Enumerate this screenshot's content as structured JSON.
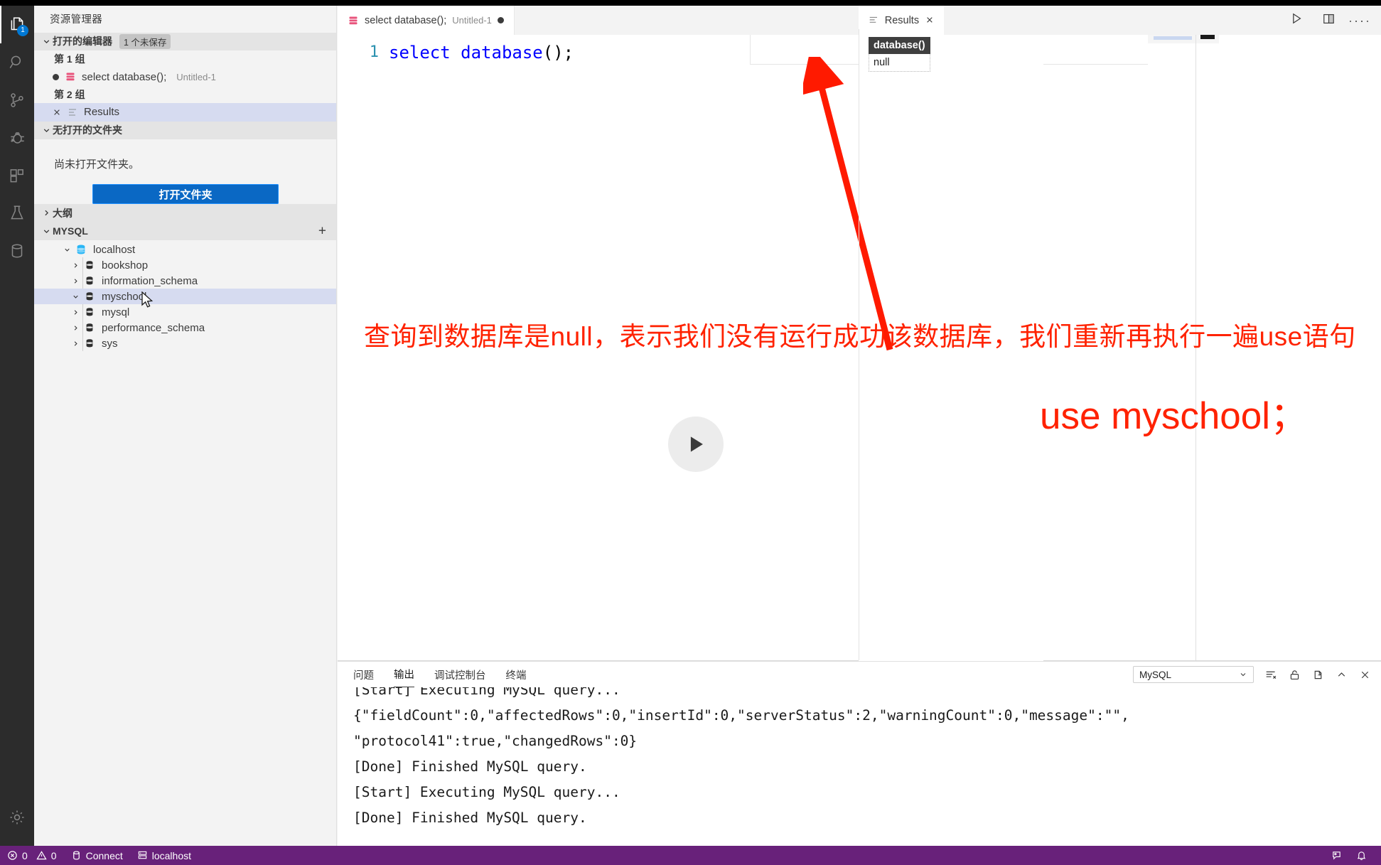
{
  "activitybar": {
    "items": [
      {
        "name": "explorer",
        "icon": "files-icon",
        "badge": "1",
        "active": true
      },
      {
        "name": "search",
        "icon": "search-icon",
        "badge": "",
        "active": false
      },
      {
        "name": "source-control",
        "icon": "source-control-icon",
        "badge": "",
        "active": false
      },
      {
        "name": "run-and-debug",
        "icon": "debug-icon",
        "badge": "",
        "active": false
      },
      {
        "name": "extensions",
        "icon": "extensions-icon",
        "badge": "",
        "active": false
      },
      {
        "name": "testing",
        "icon": "beaker-icon",
        "badge": "",
        "active": false
      },
      {
        "name": "database",
        "icon": "database-icon",
        "badge": "",
        "active": false
      }
    ],
    "settings_label": "manage-gear"
  },
  "sidebar": {
    "title": "资源管理器",
    "open_editors": {
      "label": "打开的编辑器",
      "badge": "1 个未保存",
      "groups": [
        {
          "label": "第 1 组",
          "items": [
            {
              "name": "select database();",
              "sub": "Untitled-1",
              "dirty": true,
              "selected": false
            }
          ]
        },
        {
          "label": "第 2 组",
          "items": [
            {
              "name": "Results",
              "sub": "",
              "dirty": false,
              "selected": true
            }
          ]
        }
      ]
    },
    "no_folder": {
      "label": "无打开的文件夹",
      "message": "尚未打开文件夹。",
      "button": "打开文件夹"
    },
    "outline": {
      "label": "大纲"
    },
    "mysql": {
      "label": "MYSQL",
      "add_label": "+",
      "connection": "localhost",
      "databases": [
        {
          "label": "bookshop",
          "expanded": false,
          "selected": false
        },
        {
          "label": "information_schema",
          "expanded": false,
          "selected": false
        },
        {
          "label": "myschool",
          "expanded": true,
          "selected": true
        },
        {
          "label": "mysql",
          "expanded": false,
          "selected": false
        },
        {
          "label": "performance_schema",
          "expanded": false,
          "selected": false
        },
        {
          "label": "sys",
          "expanded": false,
          "selected": false
        }
      ]
    }
  },
  "editor": {
    "tab": {
      "title": "select database();",
      "sub": "Untitled-1",
      "dirty": true
    },
    "more_actions": "···",
    "line_number": "1",
    "code": {
      "keyword1": "select",
      "keyword2": "database",
      "punct": "();"
    },
    "toolbar": {
      "run_label": "run-query",
      "split_label": "split-editor",
      "more_label": "more-actions"
    },
    "play_overlay": "play-button"
  },
  "results": {
    "tab_label": "Results",
    "close_label": "×",
    "columns": [
      "database()"
    ],
    "rows": [
      [
        "null"
      ]
    ]
  },
  "annotations": {
    "line1": "查询到数据库是null，表示我们没有运行成功该数据库，我们重新再执行一遍use语句",
    "line2": "use myschool；",
    "color": "#ff2200"
  },
  "bottom_panel": {
    "tabs": [
      {
        "label": "问题",
        "active": false
      },
      {
        "label": "输出",
        "active": true
      },
      {
        "label": "调试控制台",
        "active": false
      },
      {
        "label": "终端",
        "active": false
      }
    ],
    "channel": "MySQL",
    "actions": [
      "clear-output-icon",
      "lock-scroll-icon",
      "open-in-editor-icon",
      "chevron-up-icon",
      "close-icon"
    ],
    "output_lines": [
      "[Start] Executing MySQL query...",
      "{\"fieldCount\":0,\"affectedRows\":0,\"insertId\":0,\"serverStatus\":2,\"warningCount\":0,\"message\":\"\",",
      "\"protocol41\":true,\"changedRows\":0}",
      "[Done] Finished MySQL query.",
      "[Start] Executing MySQL query...",
      "[Done] Finished MySQL query."
    ]
  },
  "statusbar": {
    "errors": "0",
    "warnings": "0",
    "connect": "Connect",
    "host": "localhost",
    "right_icons": [
      "feedback-icon",
      "bell-icon"
    ],
    "background": "#68217a"
  }
}
